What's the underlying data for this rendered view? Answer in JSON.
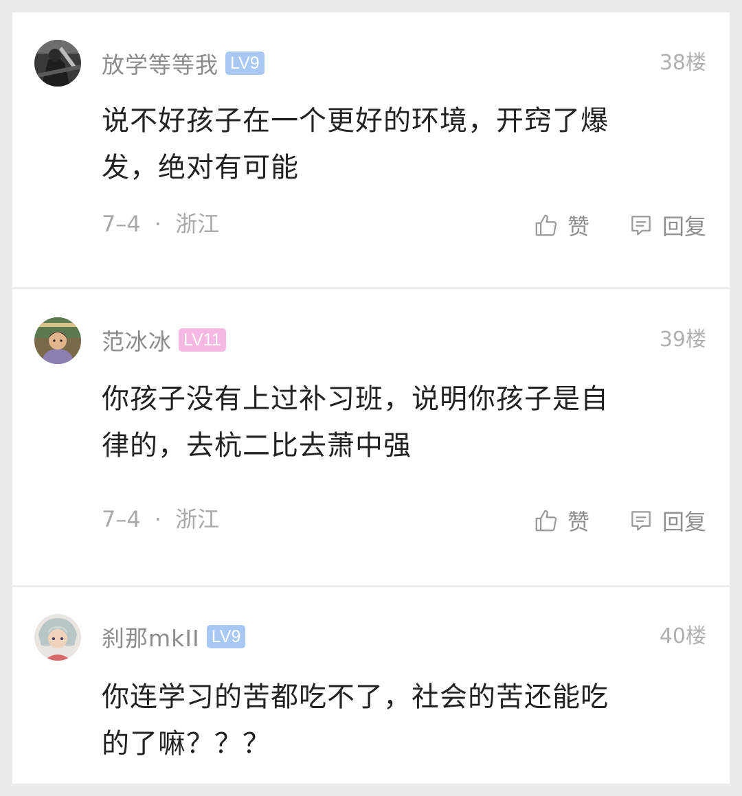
{
  "comments": [
    {
      "username": "放学等等我",
      "level": "LV9",
      "level_color": "#a9c9f5",
      "floor": "38楼",
      "text_lines": [
        "说不好孩子在一个更好的环境，开窍了爆",
        "发，绝对有可能"
      ],
      "date": "7–4",
      "location": "浙江",
      "like_label": "赞",
      "reply_label": "回复"
    },
    {
      "username": "范冰冰",
      "level": "LV11",
      "level_color": "#f4b8e3",
      "floor": "39楼",
      "text_lines": [
        "你孩子没有上过补习班，说明你孩子是自",
        "律的，去杭二比去萧中强"
      ],
      "date": "7–4",
      "location": "浙江",
      "like_label": "赞",
      "reply_label": "回复"
    },
    {
      "username": "刹那mkII",
      "level": "LV9",
      "level_color": "#a9c9f5",
      "floor": "40楼",
      "text_lines": [
        "你连学习的苦都吃不了，社会的苦还能吃",
        "的了嘛？？？"
      ]
    }
  ],
  "separator": "·",
  "icons": {
    "like": "thumbs-up-icon",
    "reply": "comment-icon"
  }
}
